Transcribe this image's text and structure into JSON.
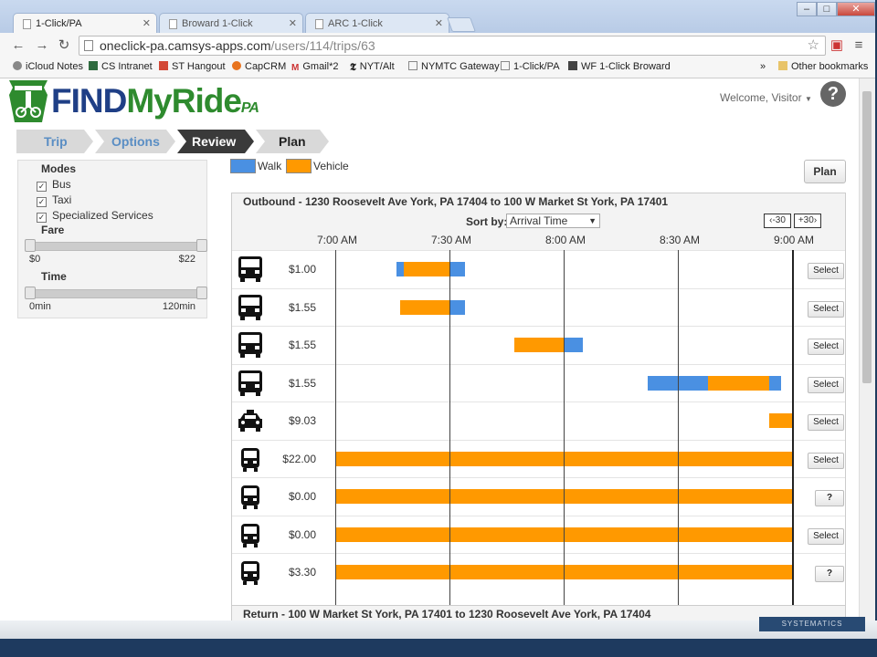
{
  "browser": {
    "tabs": [
      {
        "label": "1-Click/PA",
        "active": true
      },
      {
        "label": "Broward 1-Click",
        "active": false
      },
      {
        "label": "ARC 1-Click",
        "active": false
      }
    ],
    "url_host": "oneclick-pa.camsys-apps.com",
    "url_path": "/users/114/trips/63",
    "bookmarks": [
      "iCloud Notes",
      "CS Intranet",
      "ST Hangout",
      "CapCRM",
      "Gmail*2",
      "NYT/Alt",
      "NYMTC Gateway",
      "1-Click/PA",
      "WF 1-Click Broward"
    ],
    "bookmarks_more": "»",
    "other_bookmarks": "Other bookmarks"
  },
  "header": {
    "logo_find": "FIND",
    "logo_myride": "MyRide",
    "logo_pa": "PA",
    "welcome": "Welcome, Visitor",
    "help": "?"
  },
  "steps": [
    "Trip",
    "Options",
    "Review",
    "Plan"
  ],
  "filters": {
    "modes_heading": "Modes",
    "modes": [
      "Bus",
      "Taxi",
      "Specialized Services"
    ],
    "fare_heading": "Fare",
    "fare_min": "$0",
    "fare_max": "$22",
    "time_heading": "Time",
    "time_min": "0min",
    "time_max": "120min"
  },
  "legend": {
    "walk": "Walk",
    "vehicle": "Vehicle"
  },
  "colors": {
    "walk": "#4a90e2",
    "vehicle": "#ff9900",
    "step_active": "#3a3a3a",
    "step_inactive": "#d9d9d9",
    "step_link": "#5a8ec4"
  },
  "plan_button": "Plan",
  "outbound": {
    "title": "Outbound - 1230 Roosevelt Ave York, PA 17404 to 100 W Market St York, PA 17401",
    "sort_label": "Sort by:",
    "sort_value": "Arrival Time",
    "shift_back": "-30",
    "shift_fwd": "+30",
    "ticks": [
      "7:00 AM",
      "7:30 AM",
      "8:00 AM",
      "8:30 AM",
      "9:00 AM"
    ],
    "trips": [
      {
        "icon": "bus",
        "fare": "$1.00",
        "action": "Select",
        "segments": [
          {
            "mode": "walk",
            "start": "7:16",
            "end": "7:18"
          },
          {
            "mode": "vehicle",
            "start": "7:18",
            "end": "7:30"
          },
          {
            "mode": "walk",
            "start": "7:30",
            "end": "7:34"
          }
        ]
      },
      {
        "icon": "bus",
        "fare": "$1.55",
        "action": "Select",
        "segments": [
          {
            "mode": "vehicle",
            "start": "7:17",
            "end": "7:30"
          },
          {
            "mode": "walk",
            "start": "7:30",
            "end": "7:34"
          }
        ]
      },
      {
        "icon": "bus",
        "fare": "$1.55",
        "action": "Select",
        "segments": [
          {
            "mode": "vehicle",
            "start": "7:47",
            "end": "8:00"
          },
          {
            "mode": "walk",
            "start": "8:00",
            "end": "8:05"
          }
        ]
      },
      {
        "icon": "bus",
        "fare": "$1.55",
        "action": "Select",
        "segments": [
          {
            "mode": "walk",
            "start": "8:22",
            "end": "8:38"
          },
          {
            "mode": "vehicle",
            "start": "8:38",
            "end": "8:54"
          },
          {
            "mode": "walk",
            "start": "8:54",
            "end": "8:57"
          }
        ]
      },
      {
        "icon": "taxi",
        "fare": "$9.03",
        "action": "Select",
        "segments": [
          {
            "mode": "vehicle",
            "start": "8:54",
            "end": "9:00"
          }
        ]
      },
      {
        "icon": "van",
        "fare": "$22.00",
        "action": "Select",
        "segments": [
          {
            "mode": "vehicle",
            "start": "7:00",
            "end": "9:00"
          }
        ]
      },
      {
        "icon": "van",
        "fare": "$0.00",
        "action": "?",
        "segments": [
          {
            "mode": "vehicle",
            "start": "7:00",
            "end": "9:00"
          }
        ]
      },
      {
        "icon": "van",
        "fare": "$0.00",
        "action": "Select",
        "segments": [
          {
            "mode": "vehicle",
            "start": "7:00",
            "end": "9:00"
          }
        ]
      },
      {
        "icon": "van",
        "fare": "$3.30",
        "action": "?",
        "segments": [
          {
            "mode": "vehicle",
            "start": "7:00",
            "end": "9:00"
          }
        ]
      }
    ]
  },
  "return_title": "Return - 100 W Market St York, PA 17401 to 1230 Roosevelt Ave York, PA 17404",
  "taskbar_logo": "SYSTEMATICS"
}
